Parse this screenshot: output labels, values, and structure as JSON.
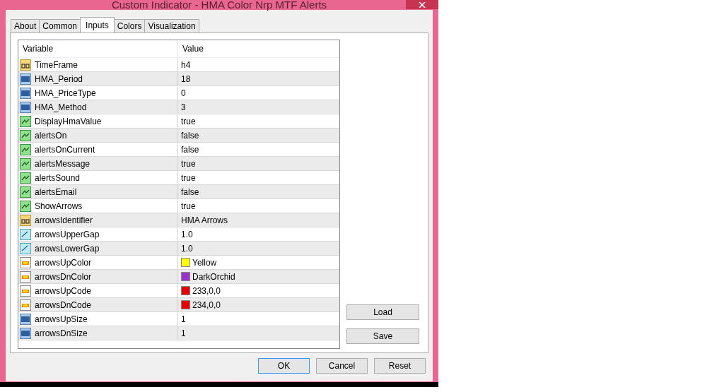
{
  "window": {
    "title": "Custom Indicator - HMA Color Nrp MTF Alerts"
  },
  "tabs": [
    {
      "label": "About",
      "selected": false
    },
    {
      "label": "Common",
      "selected": false
    },
    {
      "label": "Inputs",
      "selected": true
    },
    {
      "label": "Colors",
      "selected": false
    },
    {
      "label": "Visualization",
      "selected": false
    }
  ],
  "table": {
    "columns": [
      "Variable",
      "Value"
    ],
    "rows": [
      {
        "kind": "text",
        "variable": "TimeFrame",
        "value": "h4"
      },
      {
        "kind": "int",
        "variable": "HMA_Period",
        "value": "18"
      },
      {
        "kind": "int",
        "variable": "HMA_PriceType",
        "value": "0"
      },
      {
        "kind": "int",
        "variable": "HMA_Method",
        "value": "3"
      },
      {
        "kind": "bool",
        "variable": "DisplayHmaValue",
        "value": "true"
      },
      {
        "kind": "bool",
        "variable": "alertsOn",
        "value": "false"
      },
      {
        "kind": "bool",
        "variable": "alertsOnCurrent",
        "value": "false"
      },
      {
        "kind": "bool",
        "variable": "alertsMessage",
        "value": "true"
      },
      {
        "kind": "bool",
        "variable": "alertsSound",
        "value": "true"
      },
      {
        "kind": "bool",
        "variable": "alertsEmail",
        "value": "false"
      },
      {
        "kind": "bool",
        "variable": "ShowArrows",
        "value": "true"
      },
      {
        "kind": "text",
        "variable": "arrowsIdentifier",
        "value": "HMA Arrows"
      },
      {
        "kind": "double",
        "variable": "arrowsUpperGap",
        "value": "1.0"
      },
      {
        "kind": "double",
        "variable": "arrowsLowerGap",
        "value": "1.0"
      },
      {
        "kind": "color",
        "variable": "arrowsUpColor",
        "value": "Yellow",
        "color": "#ffff00"
      },
      {
        "kind": "color",
        "variable": "arrowsDnColor",
        "value": "DarkOrchid",
        "color": "#9932cc"
      },
      {
        "kind": "color",
        "variable": "arrowsUpCode",
        "value": "233,0,0",
        "color": "#e90000"
      },
      {
        "kind": "color",
        "variable": "arrowsDnCode",
        "value": "234,0,0",
        "color": "#ea0000"
      },
      {
        "kind": "int",
        "variable": "arrowsUpSize",
        "value": "1"
      },
      {
        "kind": "int",
        "variable": "arrowsDnSize",
        "value": "1"
      }
    ]
  },
  "side_buttons": [
    "Load",
    "Save"
  ],
  "buttons": [
    {
      "label": "OK",
      "selected": true
    },
    {
      "label": "Cancel",
      "selected": false
    },
    {
      "label": "Reset",
      "selected": false
    }
  ]
}
